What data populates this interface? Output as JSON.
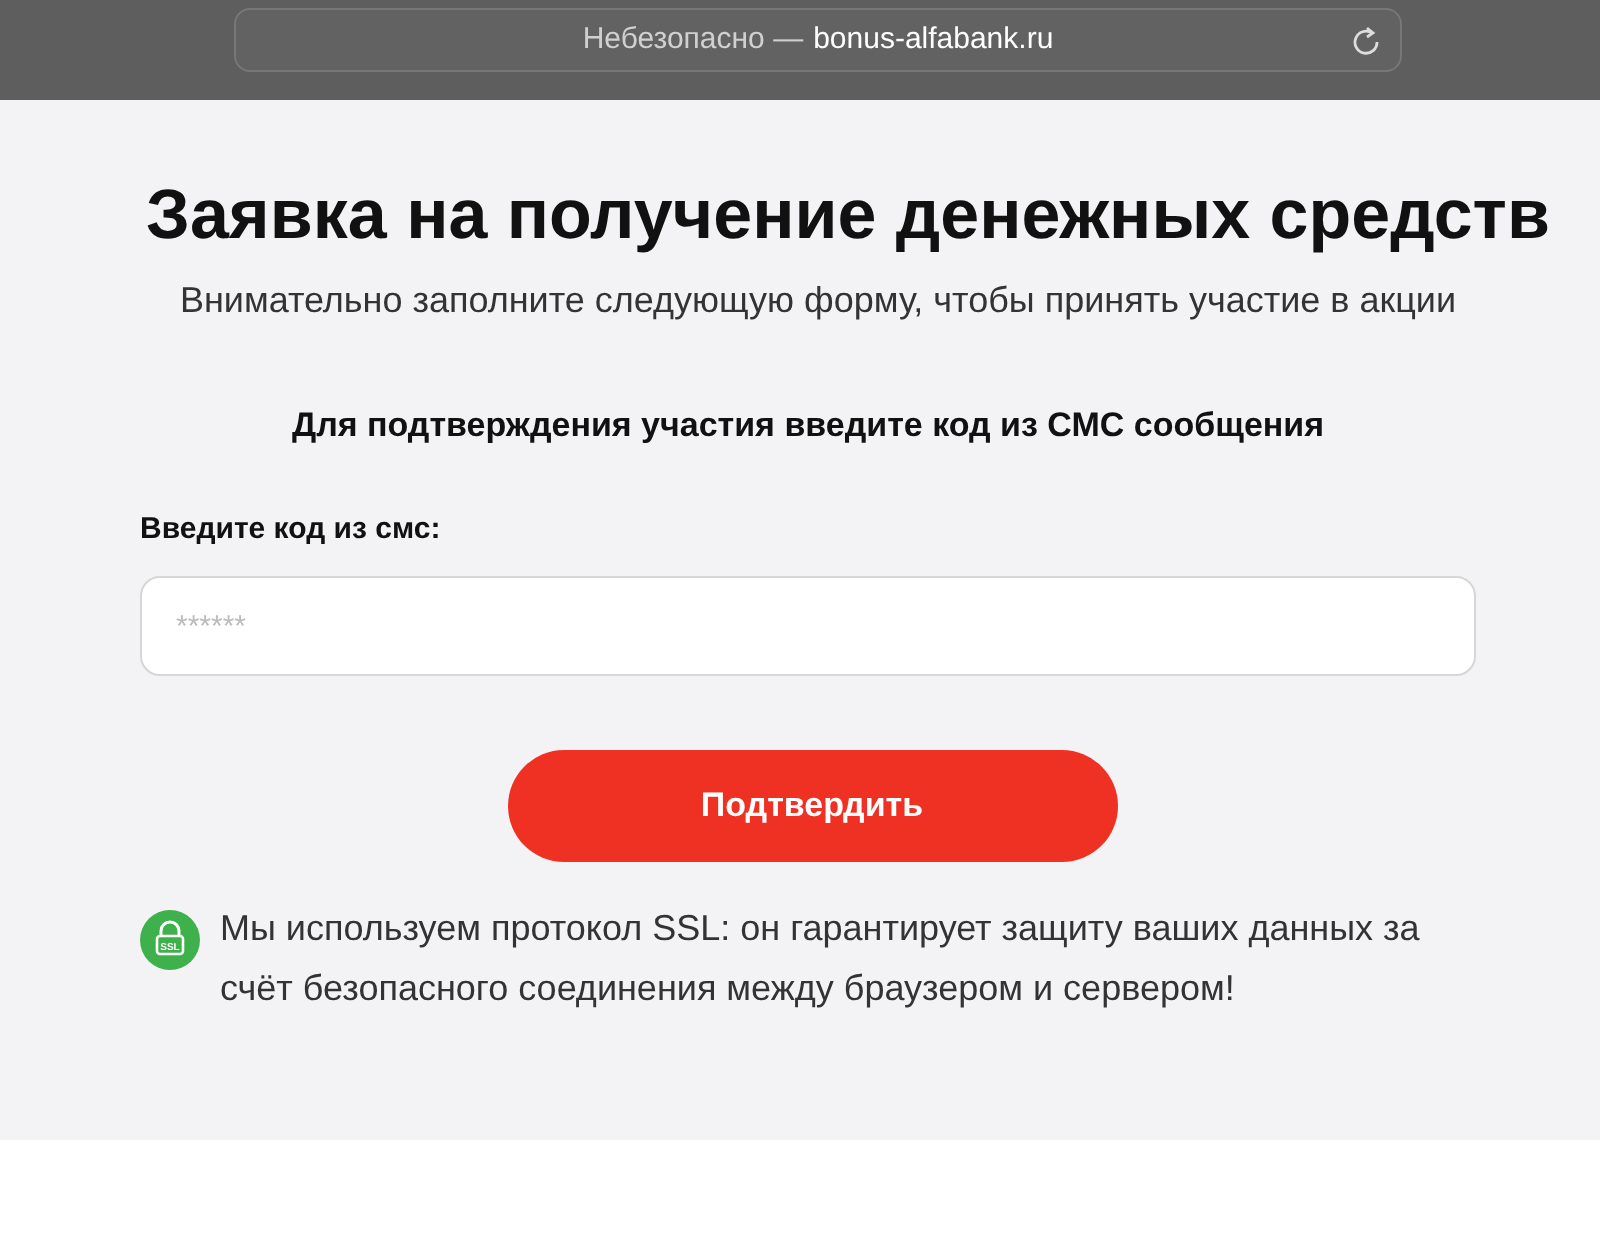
{
  "browser": {
    "security_label": "Небезопасно —",
    "domain": "bonus-alfabank.ru"
  },
  "title": "Заявка на получение денежных средств",
  "subtitle": "Внимательно заполните следующую форму, чтобы принять участие в акции",
  "form": {
    "heading": "Для подтверждения участия введите код из СМС сообщения",
    "code_label": "Введите код из смс:",
    "code_placeholder": "******",
    "submit": "Подтвердить"
  },
  "security_note": {
    "badge": "SSL",
    "text": "Мы используем протокол SSL: он гарантирует защиту ваших данных за счёт безопасного соединения между браузером и сервером!"
  }
}
